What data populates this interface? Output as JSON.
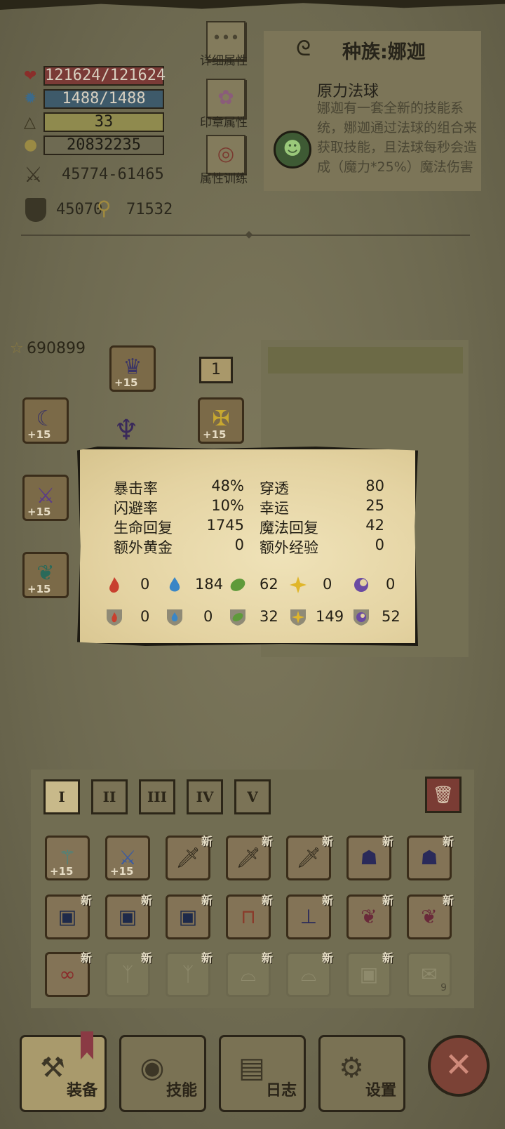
{
  "stats": {
    "hp": "121624/121624",
    "mp": "1488/1488",
    "level": "33",
    "gold": "20832235",
    "attack": "45774-61465",
    "defense": "45070",
    "power": "71532"
  },
  "side_buttons": {
    "detail": "详细属性",
    "seal": "印章属性",
    "training": "属性训练"
  },
  "race": {
    "title": "种族:娜迦",
    "skill_name": "原力法球",
    "skill_desc": "娜迦有一套全新的技能系统，娜迦通过法球的组合来获取技能，且法球每秒会造成（魔力*25%）魔法伤害"
  },
  "equipment": {
    "score": "690899",
    "slot_count": "1",
    "plus": "+15"
  },
  "popup": {
    "rows": [
      {
        "l1": "暴击率",
        "v1": "48%",
        "l2": "穿透",
        "v2": "80"
      },
      {
        "l1": "闪避率",
        "v1": "10%",
        "l2": "幸运",
        "v2": "25"
      },
      {
        "l1": "生命回复",
        "v1": "1745",
        "l2": "魔法回复",
        "v2": "42"
      },
      {
        "l1": "额外黄金",
        "v1": "0",
        "l2": "额外经验",
        "v2": "0"
      }
    ],
    "elements_attack": [
      {
        "icon": "fire-attack-icon",
        "color": "#c8402e",
        "value": "0"
      },
      {
        "icon": "water-attack-icon",
        "color": "#3a86c6",
        "value": "184"
      },
      {
        "icon": "nature-attack-icon",
        "color": "#5e9a3a",
        "value": "62"
      },
      {
        "icon": "light-attack-icon",
        "color": "#e0b62a",
        "value": "0"
      },
      {
        "icon": "dark-attack-icon",
        "color": "#6a4aa2",
        "value": "0"
      }
    ],
    "elements_resist": [
      {
        "icon": "fire-resist-icon",
        "color": "#c8402e",
        "value": "0"
      },
      {
        "icon": "water-resist-icon",
        "color": "#3a86c6",
        "value": "0"
      },
      {
        "icon": "nature-resist-icon",
        "color": "#5e9a3a",
        "value": "32"
      },
      {
        "icon": "light-resist-icon",
        "color": "#e0b62a",
        "value": "149"
      },
      {
        "icon": "dark-resist-icon",
        "color": "#6a4aa2",
        "value": "52"
      }
    ]
  },
  "inventory": {
    "tabs": [
      "I",
      "II",
      "III",
      "IV",
      "V"
    ],
    "new_badge": "新",
    "plus": "+15",
    "last_count": "9"
  },
  "nav": {
    "equip": "装备",
    "skills": "技能",
    "log": "日志",
    "settings": "设置"
  }
}
